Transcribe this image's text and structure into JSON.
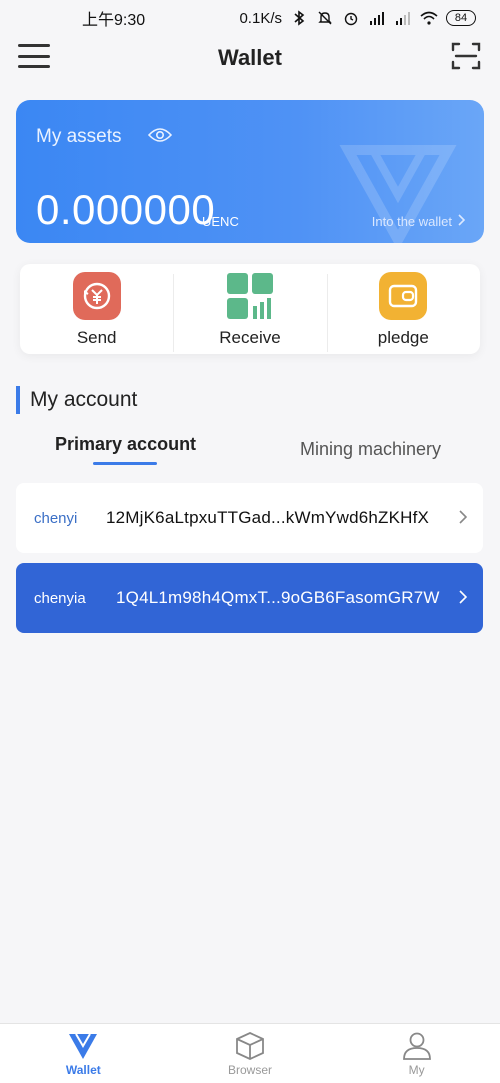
{
  "status_bar": {
    "time": "上午9:30",
    "network_speed": "0.1K/s",
    "battery": "84",
    "icons": [
      "bluetooth-icon",
      "mute-icon",
      "alarm-icon",
      "signal-icon",
      "signal-icon",
      "wifi-icon",
      "battery-icon"
    ]
  },
  "header": {
    "title": "Wallet",
    "left_icon": "menu-icon",
    "right_icon": "scan-icon"
  },
  "assets": {
    "label": "My assets",
    "value": "0.000000",
    "unit": "UENC",
    "link": "Into the wallet",
    "colors": {
      "card_start": "#3b87f3",
      "card_end": "#6aa6f7"
    }
  },
  "actions": [
    {
      "label": "Send",
      "icon": "send-icon",
      "color": "#e06a5a"
    },
    {
      "label": "Receive",
      "icon": "receive-icon",
      "color": "#5cb88a"
    },
    {
      "label": "pledge",
      "icon": "pledge-icon",
      "color": "#f2b233"
    }
  ],
  "my_account": {
    "title": "My account",
    "tabs": [
      {
        "label": "Primary account",
        "active": true
      },
      {
        "label": "Mining machinery",
        "active": false
      }
    ],
    "accounts": [
      {
        "name": "chenyi",
        "address": "12MjK6aLtpxuTTGad...kWmYwd6hZKHfX",
        "selected": false
      },
      {
        "name": "chenyia",
        "address": "1Q4L1m98h4QmxT...9oGB6FasomGR7W",
        "selected": true
      }
    ]
  },
  "bottom_nav": [
    {
      "label": "Wallet",
      "icon": "wallet-icon",
      "active": true
    },
    {
      "label": "Browser",
      "icon": "cube-icon",
      "active": false
    },
    {
      "label": "My",
      "icon": "user-icon",
      "active": false
    }
  ],
  "accent_color": "#3b7be8"
}
